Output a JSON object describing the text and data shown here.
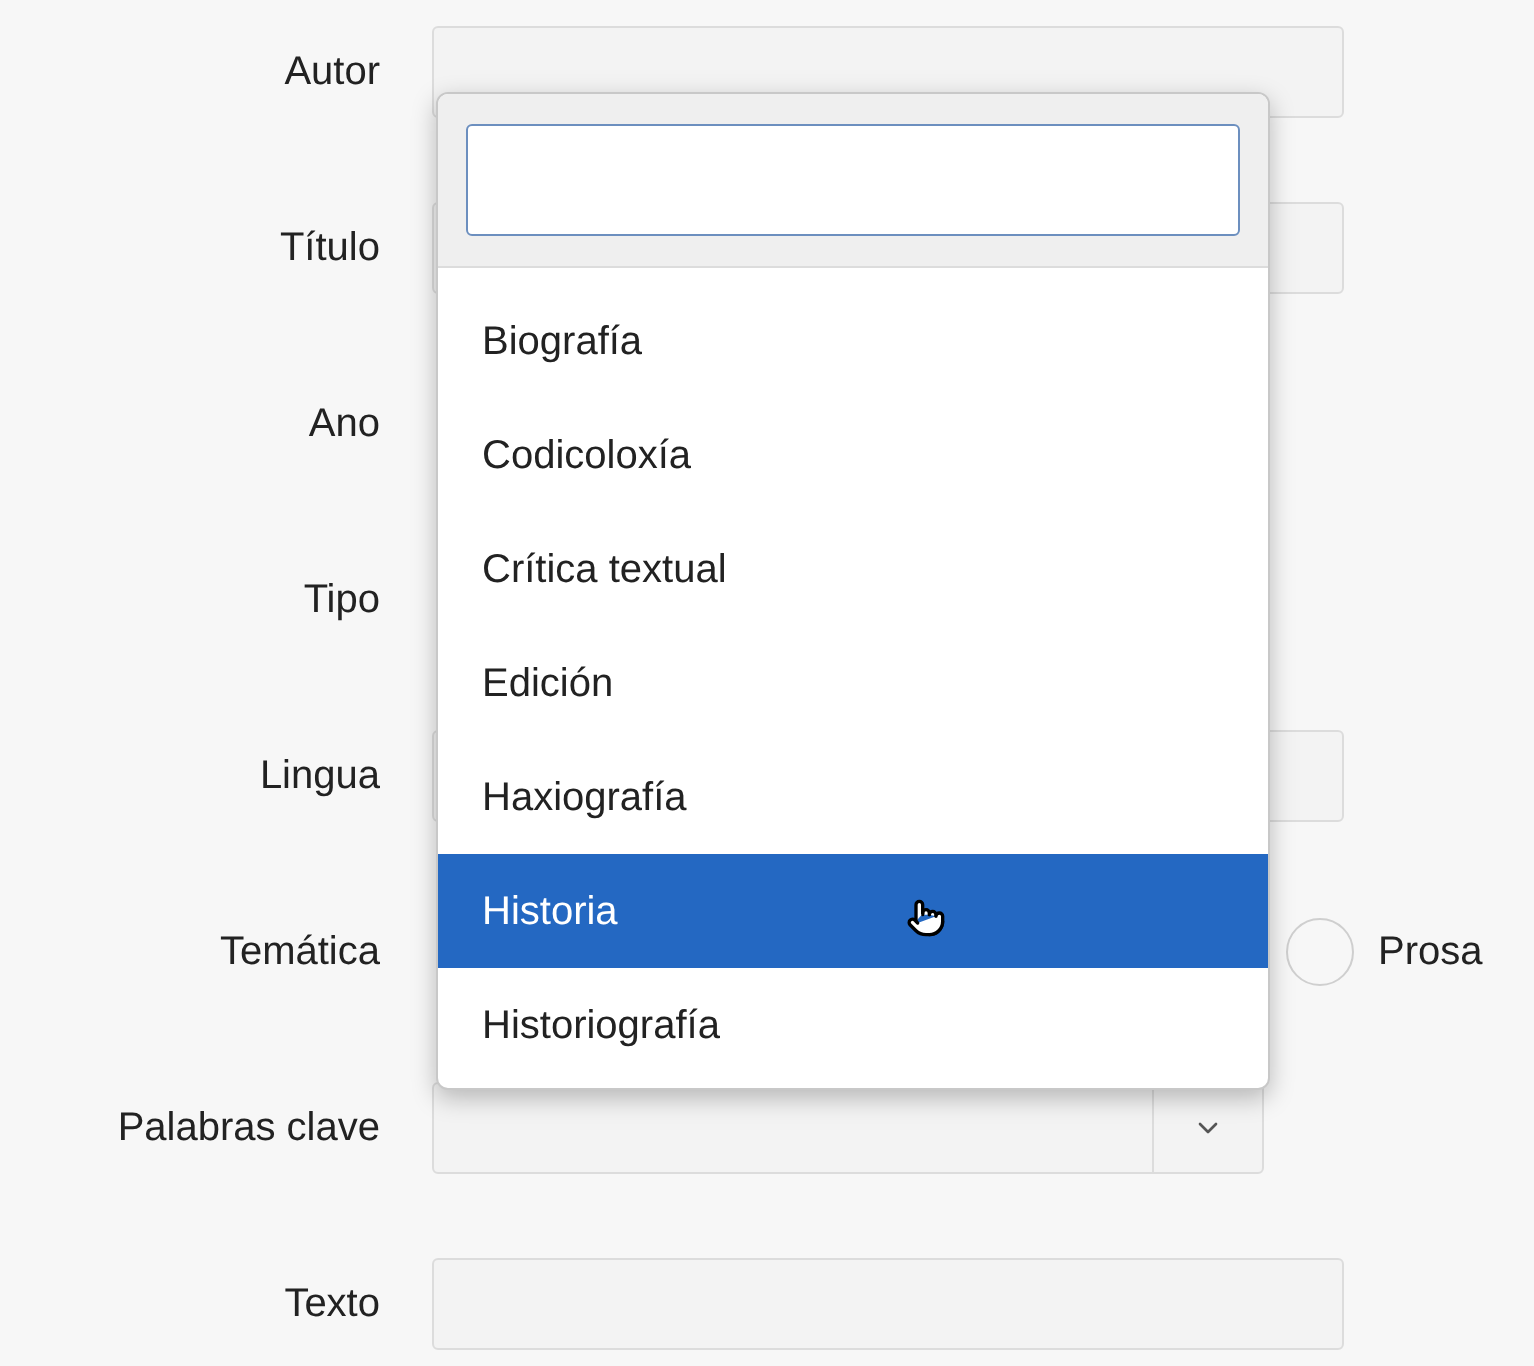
{
  "form": {
    "rows": [
      {
        "label": "Autor",
        "kind": "text"
      },
      {
        "label": "Título",
        "kind": "text"
      },
      {
        "label": "Ano",
        "kind": "hidden"
      },
      {
        "label": "Tipo",
        "kind": "hidden"
      },
      {
        "label": "Lingua",
        "kind": "text"
      },
      {
        "label": "Temática",
        "kind": "radio",
        "option": "Prosa",
        "checked": false
      },
      {
        "label": "Palabras clave",
        "kind": "select"
      },
      {
        "label": "Texto",
        "kind": "text"
      }
    ]
  },
  "dropdown": {
    "options": [
      {
        "label": "Biografía",
        "selected": false
      },
      {
        "label": "Codicoloxía",
        "selected": false
      },
      {
        "label": "Crítica textual",
        "selected": false
      },
      {
        "label": "Edición",
        "selected": false
      },
      {
        "label": "Haxiografía",
        "selected": false
      },
      {
        "label": "Historia",
        "selected": true
      },
      {
        "label": "Historiografía",
        "selected": false
      }
    ]
  }
}
